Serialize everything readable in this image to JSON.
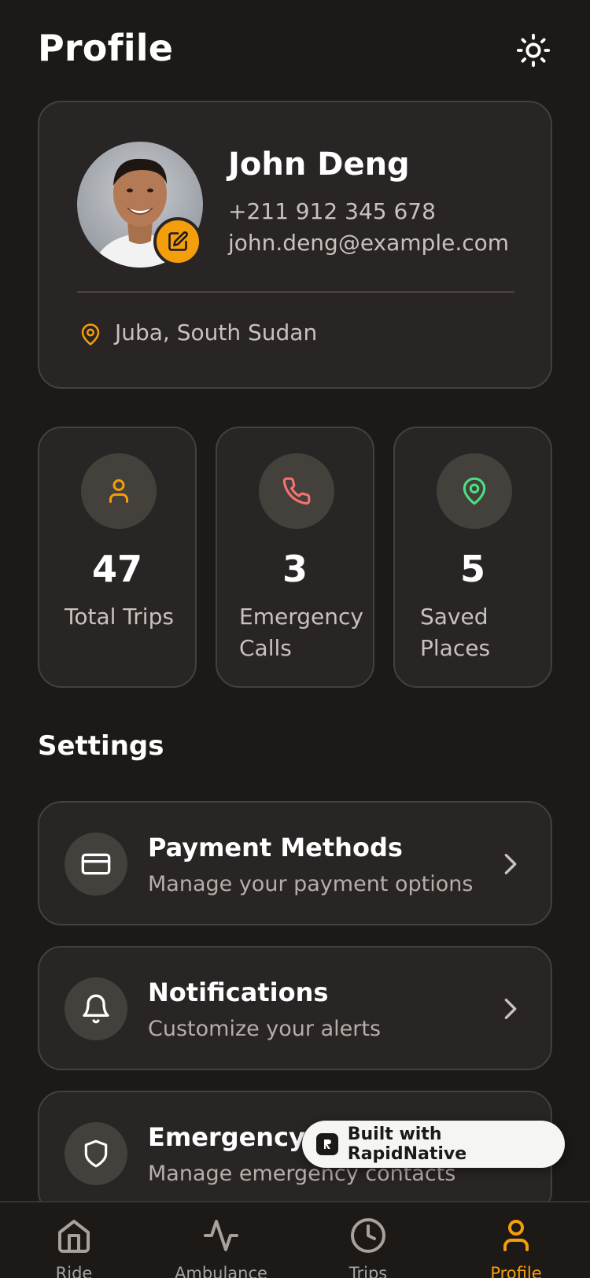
{
  "header": {
    "title": "Profile",
    "theme_icon": "sun-icon"
  },
  "profile": {
    "name": "John Deng",
    "phone": "+211 912 345 678",
    "email": "john.deng@example.com",
    "location": "Juba, South Sudan",
    "accent": "#f59e0b"
  },
  "stats": [
    {
      "value": "47",
      "label": "Total Trips",
      "icon": "user-icon",
      "color": "#f59e0b"
    },
    {
      "value": "3",
      "label": "Emergency Calls",
      "icon": "phone-icon",
      "color": "#f87171"
    },
    {
      "value": "5",
      "label": "Saved Places",
      "icon": "map-pin-icon",
      "color": "#4ade80"
    }
  ],
  "settings": {
    "title": "Settings",
    "items": [
      {
        "title": "Payment Methods",
        "subtitle": "Manage your payment options",
        "icon": "credit-card-icon"
      },
      {
        "title": "Notifications",
        "subtitle": "Customize your alerts",
        "icon": "bell-icon"
      },
      {
        "title": "Emergency C",
        "subtitle": "Manage emergency contacts",
        "icon": "shield-icon"
      }
    ]
  },
  "badge": {
    "text": "Built with RapidNative"
  },
  "nav": {
    "items": [
      {
        "label": "Ride",
        "icon": "home-icon"
      },
      {
        "label": "Ambulance",
        "icon": "activity-icon"
      },
      {
        "label": "Trips",
        "icon": "clock-icon"
      },
      {
        "label": "Profile",
        "icon": "user-icon",
        "active": true
      }
    ]
  }
}
